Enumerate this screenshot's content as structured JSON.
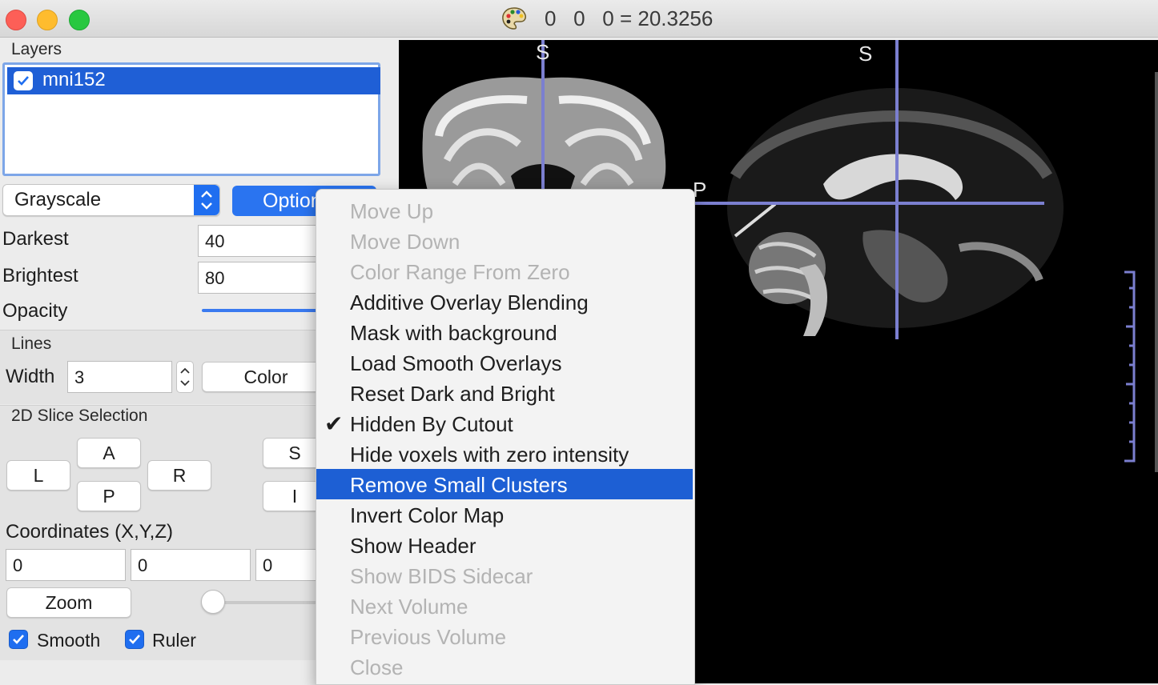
{
  "window": {
    "title": "0   0   0 = 20.3256",
    "title_icon": "palette-icon"
  },
  "layers": {
    "section_label": "Layers",
    "items": [
      {
        "name": "mni152",
        "checked": true
      }
    ]
  },
  "colormap": {
    "selected": "Grayscale",
    "options_button": "Options"
  },
  "darkest": {
    "label": "Darkest",
    "value": "40"
  },
  "brightest": {
    "label": "Brightest",
    "value": "80"
  },
  "opacity": {
    "label": "Opacity"
  },
  "lines": {
    "section_label": "Lines",
    "width_label": "Width",
    "width_value": "3",
    "color_button": "Color"
  },
  "slice_selection": {
    "section_label": "2D Slice Selection",
    "buttons": {
      "L": "L",
      "A": "A",
      "P": "P",
      "R": "R",
      "S": "S",
      "I": "I"
    }
  },
  "coordinates": {
    "label": "Coordinates (X,Y,Z)",
    "x": "0",
    "y": "0",
    "z": "0"
  },
  "zoom": {
    "button": "Zoom"
  },
  "checkboxes": {
    "smooth": {
      "label": "Smooth",
      "checked": true
    },
    "ruler": {
      "label": "Ruler",
      "checked": true
    }
  },
  "viewer": {
    "orientation_labels": {
      "coronal_top": "S",
      "sagittal_top": "S",
      "sagittal_left": "P"
    }
  },
  "menu": {
    "items": [
      {
        "label": "Move Up",
        "enabled": false
      },
      {
        "label": "Move Down",
        "enabled": false
      },
      {
        "label": "Color Range From Zero",
        "enabled": false
      },
      {
        "label": "Additive Overlay Blending",
        "enabled": true
      },
      {
        "label": "Mask with background",
        "enabled": true
      },
      {
        "label": "Load Smooth Overlays",
        "enabled": true
      },
      {
        "label": "Reset Dark and Bright",
        "enabled": true
      },
      {
        "label": "Hidden By Cutout",
        "enabled": true,
        "checked": true
      },
      {
        "label": "Hide voxels with zero intensity",
        "enabled": true
      },
      {
        "label": "Remove Small Clusters",
        "enabled": true,
        "highlighted": true
      },
      {
        "label": "Invert Color Map",
        "enabled": true
      },
      {
        "label": "Show Header",
        "enabled": true
      },
      {
        "label": "Show BIDS Sidecar",
        "enabled": false
      },
      {
        "label": "Next Volume",
        "enabled": false
      },
      {
        "label": "Previous Volume",
        "enabled": false
      },
      {
        "label": "Close",
        "enabled": false
      }
    ]
  },
  "colors": {
    "accent": "#1f6ef0",
    "highlight": "#1d5fd4",
    "crosshair": "#7b7fd0",
    "viewer_bg": "#000000"
  }
}
